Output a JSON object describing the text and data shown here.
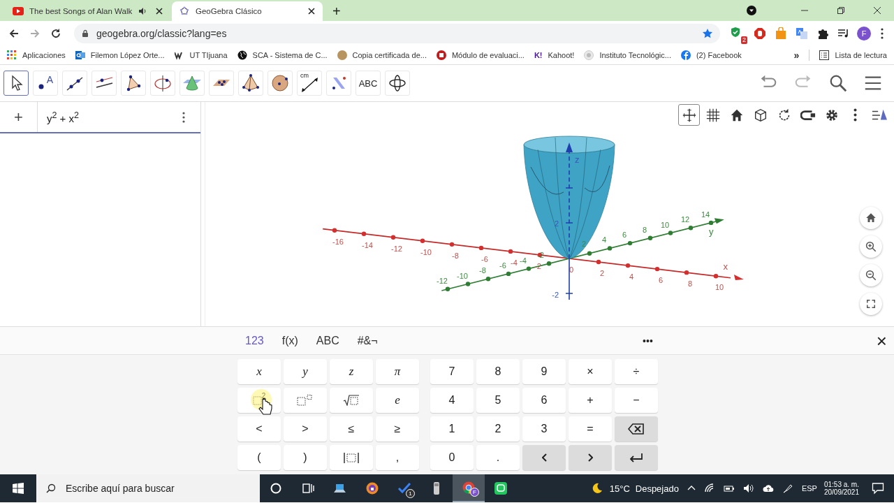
{
  "browser": {
    "tabs": [
      {
        "title": "The best Songs of Alan Walk",
        "selected": false,
        "audio": true,
        "kind": "video"
      },
      {
        "title": "GeoGebra Clásico",
        "selected": true,
        "audio": false,
        "kind": "geogebra"
      }
    ],
    "new_tab": "+",
    "url": "geogebra.org/classic?lang=es",
    "extension_badge": "2",
    "profile": "F",
    "bookmarks": [
      {
        "label": "Aplicaciones",
        "kind": "apps"
      },
      {
        "label": "Filemon López Orte...",
        "kind": "mail"
      },
      {
        "label": "UT TIjuana",
        "kind": "w"
      },
      {
        "label": "SCA - Sistema de C...",
        "kind": "globe"
      },
      {
        "label": "Copia certificada de...",
        "kind": "dot"
      },
      {
        "label": "Módulo de evaluaci...",
        "kind": "stop"
      },
      {
        "label": "Kahoot!",
        "kind": "mark",
        "icon_text": "K!"
      },
      {
        "label": "Instituto Tecnológic...",
        "kind": "seal"
      },
      {
        "label": "(2) Facebook",
        "kind": "facebook"
      }
    ],
    "bookmarks_more": "»",
    "reading_list": "Lista de lectura"
  },
  "toolbar": {
    "tools": [
      {
        "kind": "move",
        "selected": true
      },
      {
        "kind": "point",
        "label": "A",
        "selected": false
      },
      {
        "kind": "line",
        "selected": false
      },
      {
        "kind": "parallel",
        "selected": false
      },
      {
        "kind": "polygon",
        "selected": false
      },
      {
        "kind": "rotate-axis",
        "selected": false
      },
      {
        "kind": "cone",
        "selected": false
      },
      {
        "kind": "plane",
        "selected": false
      },
      {
        "kind": "pyramid",
        "selected": false
      },
      {
        "kind": "sphere",
        "selected": false
      },
      {
        "kind": "distance",
        "label": "cm",
        "selected": false
      },
      {
        "kind": "reflect",
        "selected": false
      },
      {
        "kind": "text",
        "label": "ABC",
        "selected": false
      },
      {
        "kind": "view",
        "selected": false
      }
    ]
  },
  "algebra": {
    "add": "+",
    "input": "y$^{2}$ + x$^{2}$"
  },
  "view3d": {
    "x_label": "x",
    "y_label": "y",
    "z_label": "z",
    "x_ticks": [
      "-16",
      "-14",
      "-12",
      "-10",
      "-8",
      "-6",
      "-4",
      "-2",
      "0",
      "2",
      "4",
      "6",
      "8",
      "10"
    ],
    "y_ticks": [
      "-12",
      "-10",
      "-8",
      "-6",
      "-4",
      "-2",
      "2",
      "4",
      "6",
      "8",
      "10",
      "12",
      "14"
    ],
    "z_ticks": [
      "2",
      "-2"
    ],
    "tools": [
      {
        "kind": "axes",
        "selected": true
      },
      {
        "kind": "grid",
        "selected": false
      },
      {
        "kind": "home",
        "selected": false
      },
      {
        "kind": "cube",
        "selected": false
      },
      {
        "kind": "rotate",
        "selected": false
      },
      {
        "kind": "clip",
        "selected": false
      },
      {
        "kind": "gear",
        "selected": false
      },
      {
        "kind": "more",
        "selected": false
      },
      {
        "kind": "style",
        "selected": false
      }
    ]
  },
  "keyboard": {
    "tabs": [
      {
        "label": "123",
        "selected": true
      },
      {
        "label": "f(x)",
        "selected": false
      },
      {
        "label": "ABC",
        "selected": false
      },
      {
        "label": "#&¬",
        "selected": false
      }
    ],
    "more": "•••",
    "close": "×",
    "left_keys": [
      {
        "kind": "var",
        "label": "x"
      },
      {
        "kind": "var",
        "label": "y"
      },
      {
        "kind": "var",
        "label": "z"
      },
      {
        "kind": "var",
        "label": "π"
      },
      {
        "kind": "square",
        "label": "2"
      },
      {
        "kind": "power"
      },
      {
        "kind": "sqrt"
      },
      {
        "kind": "var",
        "label": "e"
      },
      {
        "kind": "text",
        "label": "<"
      },
      {
        "kind": "text",
        "label": ">"
      },
      {
        "kind": "text",
        "label": "≤"
      },
      {
        "kind": "text",
        "label": "≥"
      },
      {
        "kind": "text",
        "label": "("
      },
      {
        "kind": "text",
        "label": ")"
      },
      {
        "kind": "abs"
      },
      {
        "kind": "text",
        "label": ","
      }
    ],
    "right_keys": [
      {
        "kind": "text",
        "label": "7"
      },
      {
        "kind": "text",
        "label": "8"
      },
      {
        "kind": "text",
        "label": "9"
      },
      {
        "kind": "text",
        "label": "×"
      },
      {
        "kind": "text",
        "label": "÷"
      },
      {
        "kind": "text",
        "label": "4"
      },
      {
        "kind": "text",
        "label": "5"
      },
      {
        "kind": "text",
        "label": "6"
      },
      {
        "kind": "text",
        "label": "+"
      },
      {
        "kind": "text",
        "label": "−"
      },
      {
        "kind": "text",
        "label": "1"
      },
      {
        "kind": "text",
        "label": "2"
      },
      {
        "kind": "text",
        "label": "3"
      },
      {
        "kind": "text",
        "label": "="
      },
      {
        "kind": "backspace"
      },
      {
        "kind": "text",
        "label": "0"
      },
      {
        "kind": "text",
        "label": "."
      },
      {
        "kind": "left"
      },
      {
        "kind": "right"
      },
      {
        "kind": "enter"
      }
    ]
  },
  "taskbar": {
    "search_placeholder": "Escribe aquí para buscar",
    "apps": [
      {
        "kind": "cortana",
        "active": false
      },
      {
        "kind": "taskview",
        "active": false
      },
      {
        "kind": "laptop",
        "active": false
      },
      {
        "kind": "browser",
        "active": false
      },
      {
        "kind": "todo",
        "badge": "1",
        "active": false
      },
      {
        "kind": "usb",
        "active": false
      },
      {
        "kind": "chrome",
        "badge": "F",
        "active": true
      },
      {
        "kind": "chat",
        "active": false
      }
    ],
    "temperature": "15°C",
    "weather": "Despejado",
    "language": "ESP",
    "time": "01:53 a. m.",
    "date": "20/09/2021"
  }
}
